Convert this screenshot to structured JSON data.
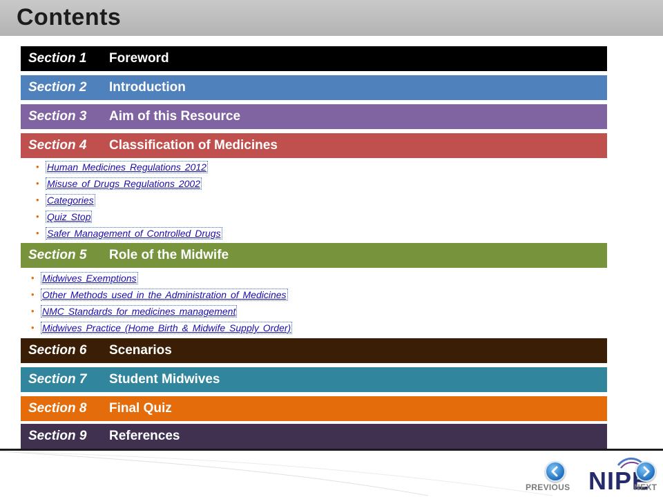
{
  "page": {
    "title": "Contents"
  },
  "sections": [
    {
      "number": "Section 1",
      "name": "Foreword",
      "color": "#000000"
    },
    {
      "number": "Section 2",
      "name": "Introduction",
      "color": "#4f81bd"
    },
    {
      "number": "Section 3",
      "name": "Aim of this Resource",
      "color": "#8064a2"
    },
    {
      "number": "Section 4",
      "name": "Classification of Medicines",
      "color": "#c0504d",
      "links": [
        "Human  Medicines  Regulations  2012",
        "Misuse  of  Drugs  Regulations  2002",
        "Categories",
        "Quiz  Stop",
        "Safer  Management  of  Controlled  Drugs"
      ]
    },
    {
      "number": "Section 5",
      "name": "Role of the Midwife",
      "color": "#77933c",
      "links": [
        "Midwives  Exemptions",
        "Other  Methods  used  in  the  Administration  of  Medicines",
        "NMC  Standards  for  medicines  management",
        "Midwives  Practice  (Home  Birth  &  Midwife  Supply  Order)"
      ]
    },
    {
      "number": "Section 6",
      "name": "Scenarios",
      "color": "#3a1e05"
    },
    {
      "number": "Section 7",
      "name": "Student Midwives",
      "color": "#31859c"
    },
    {
      "number": "Section 8",
      "name": "Final Quiz",
      "color": "#e46c0a"
    },
    {
      "number": "Section 9",
      "name": "References",
      "color": "#403151"
    }
  ],
  "footer": {
    "previous_label": "PREVIOUS",
    "next_label": "NEXT",
    "logo_text": "NIPE",
    "previous_icon": "chevron-left-icon",
    "next_icon": "chevron-right-icon"
  }
}
